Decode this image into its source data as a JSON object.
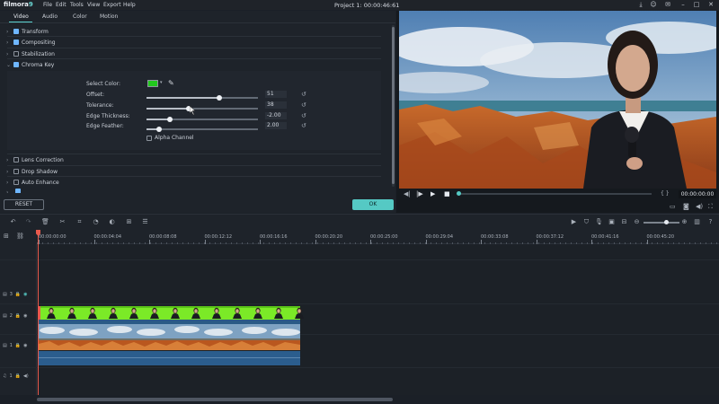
{
  "app": {
    "logo_main": "filmora",
    "logo_num": "9",
    "menu": [
      "File",
      "Edit",
      "Tools",
      "View",
      "Export",
      "Help"
    ],
    "project_title": "Project 1: 00:00:46:61"
  },
  "window_icons": [
    "download-icon",
    "user-icon",
    "mail-icon",
    "minimize-icon",
    "maximize-icon",
    "close-icon"
  ],
  "props": {
    "tabs": [
      "Video",
      "Audio",
      "Color",
      "Motion"
    ],
    "active_tab": "Video",
    "sections_top": [
      {
        "label": "Transform",
        "checked": true
      },
      {
        "label": "Compositing",
        "checked": true
      },
      {
        "label": "Stabilization",
        "checked": false
      },
      {
        "label": "Chroma Key",
        "checked": true,
        "expanded": true
      }
    ],
    "chroma": {
      "select_color_label": "Select Color:",
      "select_color": "#22c81e",
      "params": [
        {
          "label": "Offset:",
          "value": "51",
          "fraction": 0.65
        },
        {
          "label": "Tolerance:",
          "value": "38",
          "fraction": 0.38
        },
        {
          "label": "Edge Thickness:",
          "value": "-2.00",
          "fraction": 0.21
        },
        {
          "label": "Edge Feather:",
          "value": "2.00",
          "fraction": 0.11
        }
      ],
      "alpha_label": "Alpha Channel",
      "alpha_checked": false
    },
    "sections_bottom": [
      {
        "label": "Lens Correction",
        "checked": false
      },
      {
        "label": "Drop Shadow",
        "checked": false
      },
      {
        "label": "Auto Enhance",
        "checked": false
      }
    ],
    "reset_label": "RESET",
    "ok_label": "OK"
  },
  "preview": {
    "timecode": "00:00:00:00",
    "progress": 0.0,
    "accent": "#55c9c4"
  },
  "timeline": {
    "ruler_ticks": [
      "00:00:00:00",
      "00:00:04:04",
      "00:00:08:08",
      "00:00:12:12",
      "00:00:16:16",
      "00:00:20:20",
      "00:00:25:00",
      "00:00:29:04",
      "00:00:33:08",
      "00:00:37:12",
      "00:00:41:16",
      "00:00:45:20"
    ],
    "tracks": [
      {
        "num": "3"
      },
      {
        "num": "2"
      },
      {
        "num": "1"
      },
      {
        "num": "1",
        "audio": true
      }
    ]
  }
}
